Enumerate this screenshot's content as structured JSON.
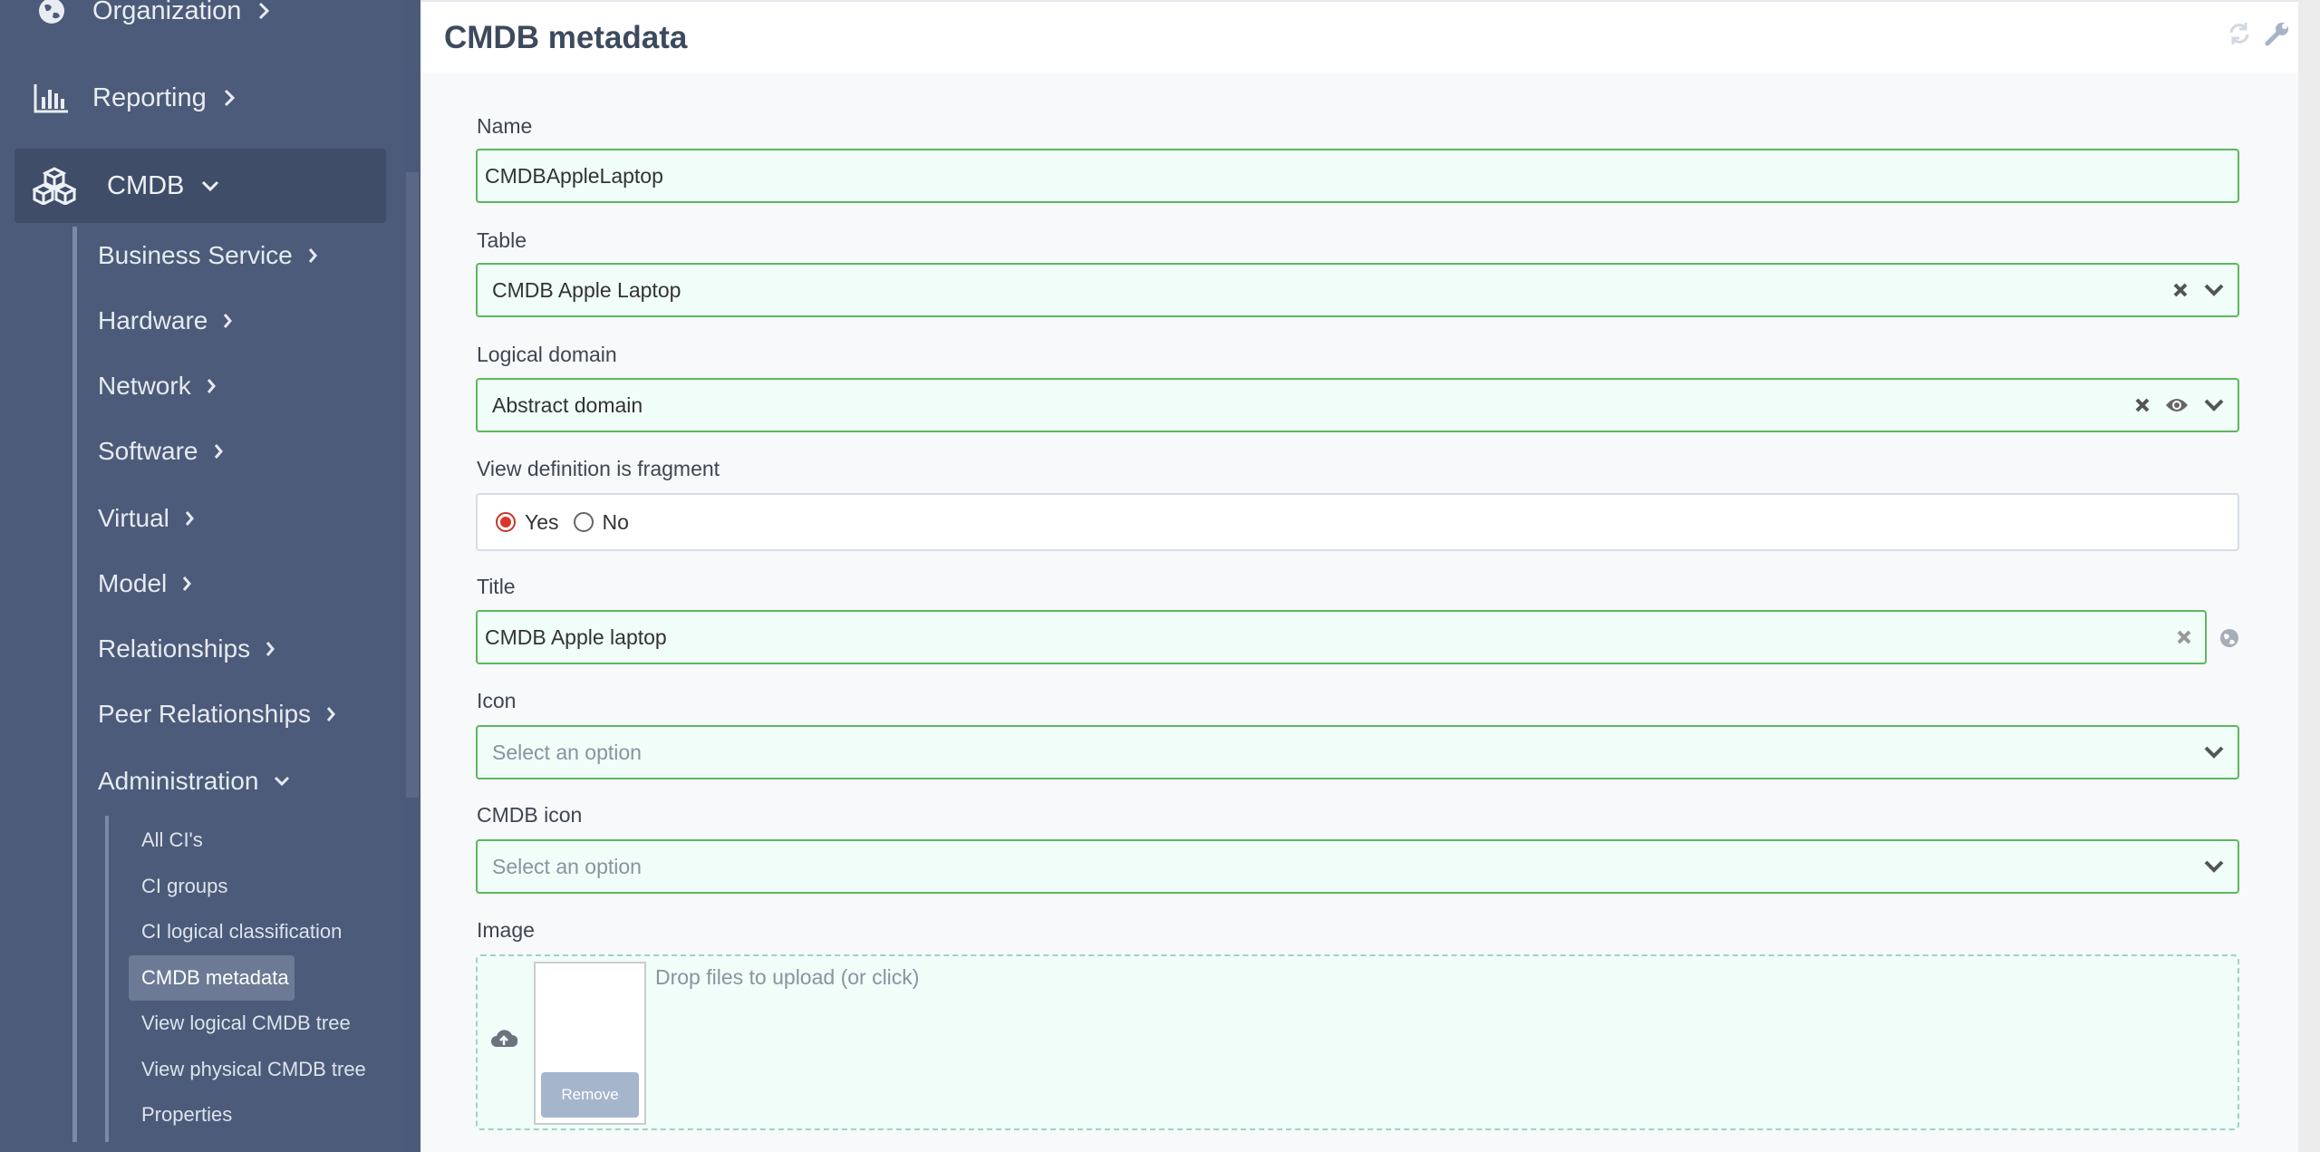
{
  "sidebar": {
    "top_items": [
      {
        "label": "Organization",
        "icon": "globe-icon"
      },
      {
        "label": "Reporting",
        "icon": "bar-chart-icon"
      }
    ],
    "cmdb": {
      "label": "CMDB",
      "icon": "cubes-icon"
    },
    "cmdb_items": [
      {
        "label": "Business Service"
      },
      {
        "label": "Hardware"
      },
      {
        "label": "Network"
      },
      {
        "label": "Software"
      },
      {
        "label": "Virtual"
      },
      {
        "label": "Model"
      },
      {
        "label": "Relationships"
      },
      {
        "label": "Peer Relationships"
      },
      {
        "label": "Administration"
      }
    ],
    "admin_items": [
      {
        "label": "All CI's"
      },
      {
        "label": "CI groups"
      },
      {
        "label": "CI logical classification"
      },
      {
        "label": "CMDB metadata"
      },
      {
        "label": "View logical CMDB tree"
      },
      {
        "label": "View physical CMDB tree"
      },
      {
        "label": "Properties"
      }
    ]
  },
  "page": {
    "title": "CMDB metadata"
  },
  "form": {
    "name": {
      "label": "Name",
      "value": "CMDBAppleLaptop"
    },
    "table": {
      "label": "Table",
      "value": "CMDB Apple Laptop"
    },
    "logical_domain": {
      "label": "Logical domain",
      "value": "Abstract domain"
    },
    "fragment": {
      "label": "View definition is fragment",
      "yes": "Yes",
      "no": "No",
      "selected": "Yes"
    },
    "title": {
      "label": "Title",
      "value": "CMDB Apple laptop"
    },
    "icon": {
      "label": "Icon",
      "placeholder": "Select an option"
    },
    "cmdb_icon": {
      "label": "CMDB icon",
      "placeholder": "Select an option"
    },
    "image": {
      "label": "Image",
      "drop_text": "Drop files to upload (or click)",
      "remove": "Remove"
    }
  },
  "colors": {
    "sidebar": "#4c5b79",
    "field_border": "#5cb85c",
    "field_bg": "#f0fdf9",
    "radio_on": "#d9362b"
  }
}
